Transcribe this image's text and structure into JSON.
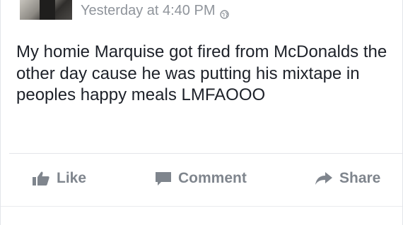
{
  "post": {
    "timestamp": "Yesterday at 4:40 PM",
    "privacy_icon": "globe-icon",
    "text": "My homie Marquise got fired from McDonalds the other day cause he was putting his mixtape in peoples happy meals LMFAOOO"
  },
  "actions": {
    "like_label": "Like",
    "comment_label": "Comment",
    "share_label": "Share"
  },
  "colors": {
    "text": "#1d2129",
    "meta": "#8f949b",
    "action": "#7f858d",
    "divider": "#e3e5ea"
  }
}
